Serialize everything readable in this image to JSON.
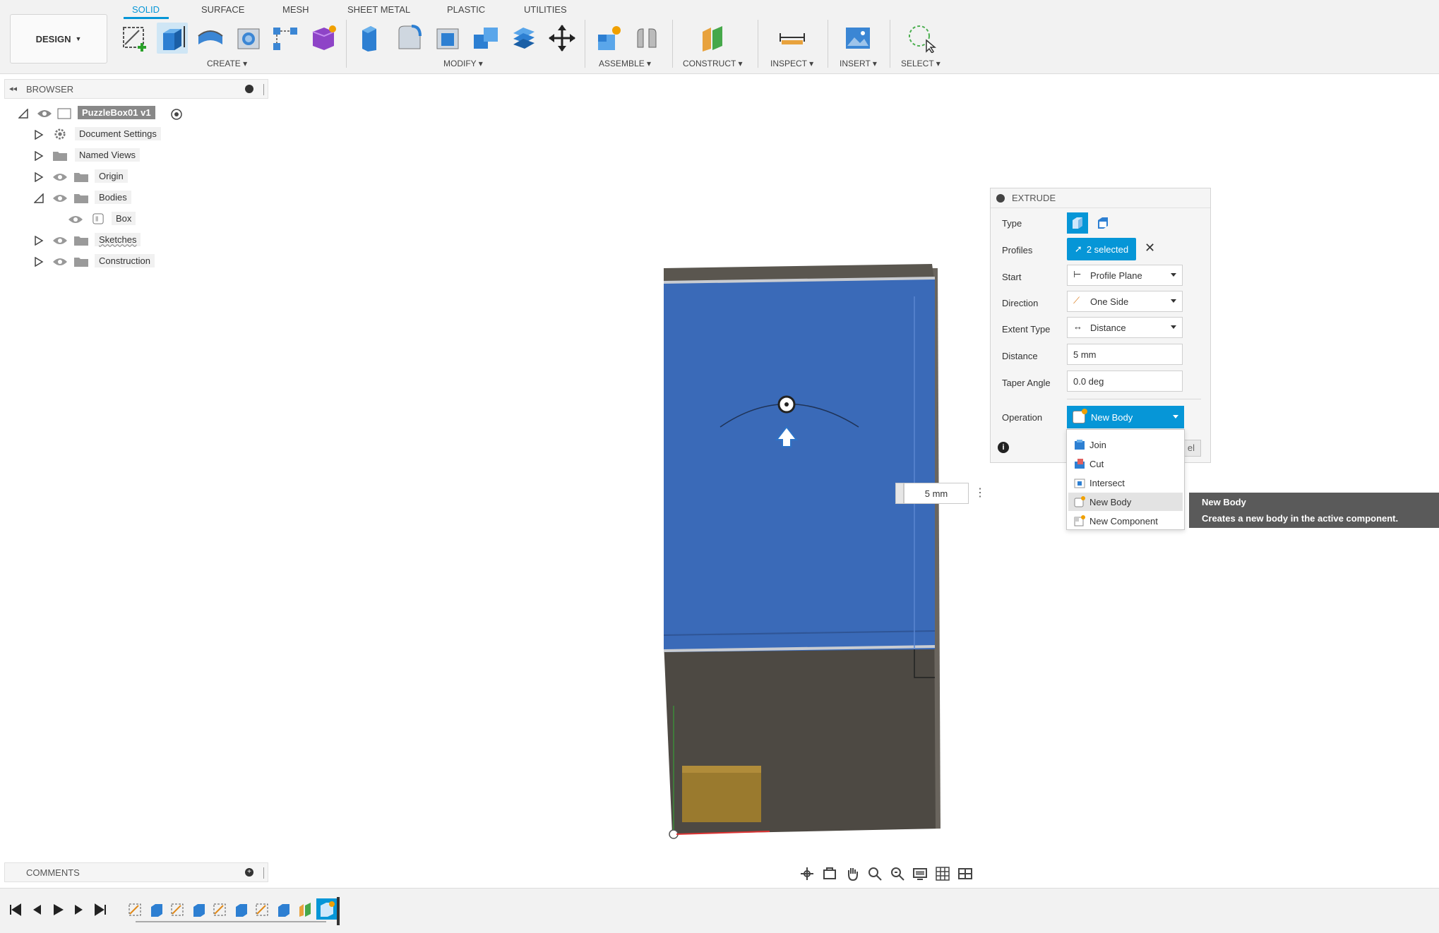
{
  "toolbar": {
    "workspace_label": "DESIGN",
    "tabs": [
      {
        "label": "SOLID"
      },
      {
        "label": "SURFACE"
      },
      {
        "label": "MESH"
      },
      {
        "label": "SHEET METAL"
      },
      {
        "label": "PLASTIC"
      },
      {
        "label": "UTILITIES"
      }
    ],
    "groups": {
      "create": "CREATE",
      "modify": "MODIFY",
      "assemble": "ASSEMBLE",
      "construct": "CONSTRUCT",
      "inspect": "INSPECT",
      "insert": "INSERT",
      "select": "SELECT"
    },
    "accent_color": "#0696d7"
  },
  "browser": {
    "title": "BROWSER",
    "root": "PuzzleBox01 v1",
    "items": [
      {
        "label": "Document Settings",
        "icon": "gear-icon"
      },
      {
        "label": "Named Views",
        "icon": "folder-icon"
      },
      {
        "label": "Origin",
        "icon": "folder-icon"
      },
      {
        "label": "Bodies",
        "icon": "folder-icon"
      },
      {
        "label": "Box",
        "icon": "body-icon"
      },
      {
        "label": "Sketches",
        "icon": "folder-icon"
      },
      {
        "label": "Construction",
        "icon": "folder-icon"
      }
    ]
  },
  "comments": {
    "title": "COMMENTS"
  },
  "extrude": {
    "title": "EXTRUDE",
    "type_label": "Type",
    "profiles_label": "Profiles",
    "profiles_value": "2 selected",
    "start_label": "Start",
    "start_value": "Profile Plane",
    "direction_label": "Direction",
    "direction_value": "One Side",
    "extent_label": "Extent Type",
    "extent_value": "Distance",
    "distance_label": "Distance",
    "distance_value": "5 mm",
    "taper_label": "Taper Angle",
    "taper_value": "0.0 deg",
    "operation_label": "Operation",
    "operation_value": "New Body",
    "cancel_partial": "el"
  },
  "operation_menu": [
    {
      "label": "Join"
    },
    {
      "label": "Cut"
    },
    {
      "label": "Intersect"
    },
    {
      "label": "New Body"
    },
    {
      "label": "New Component"
    }
  ],
  "tooltip": {
    "title": "New Body",
    "description": "Creates a new body in the active component."
  },
  "viewport": {
    "dimension_value": "5 mm",
    "selection_color": "#3a6ab8",
    "body_color": "#4d4943"
  }
}
